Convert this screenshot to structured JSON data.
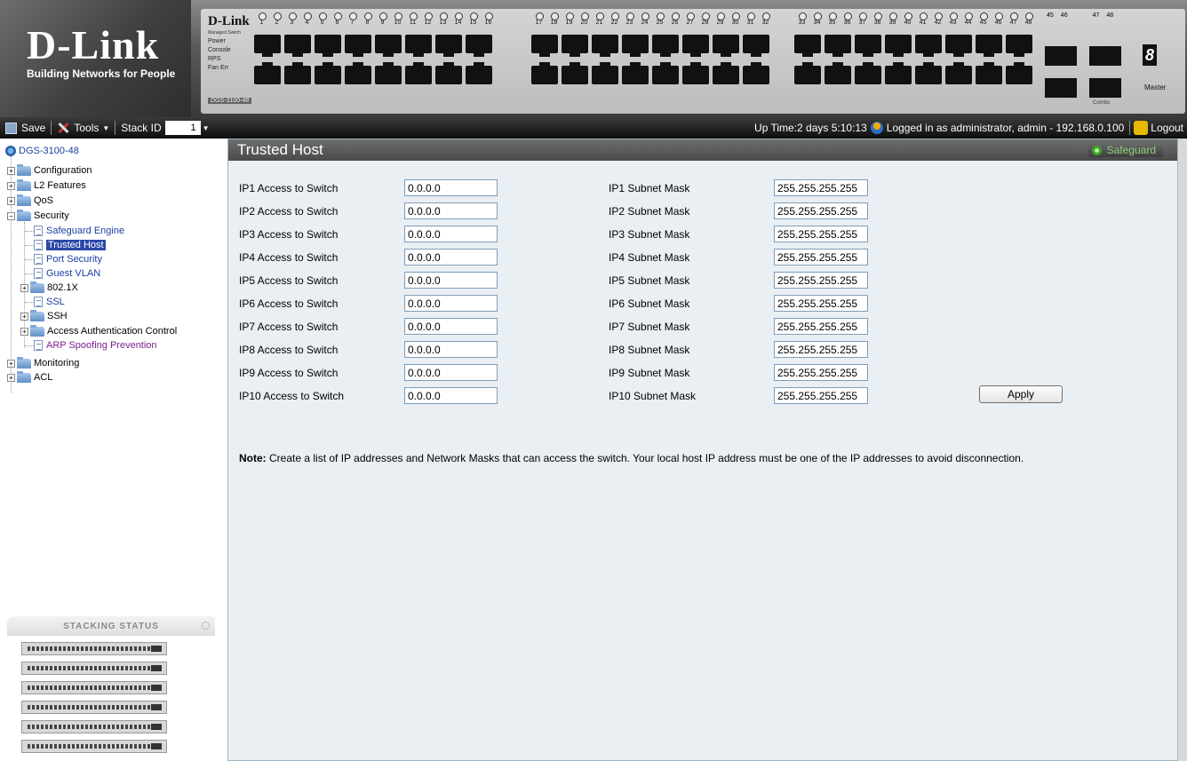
{
  "banner": {
    "logo": "D-Link",
    "tagline": "Building Networks for People",
    "switch_brand": "D-Link",
    "switch_subtitle": "Managed Switch",
    "leds": [
      "Power",
      "Console",
      "RPS",
      "Fan Err"
    ],
    "model": "DGS-3100-48",
    "port_numbers_1": [
      "1",
      "2",
      "3",
      "4",
      "5",
      "6",
      "7",
      "8",
      "9",
      "10",
      "11",
      "12",
      "13",
      "14",
      "15",
      "16"
    ],
    "port_numbers_2": [
      "17",
      "18",
      "19",
      "20",
      "21",
      "22",
      "23",
      "24",
      "25",
      "26",
      "27",
      "28",
      "29",
      "30",
      "31",
      "32"
    ],
    "port_numbers_3": [
      "33",
      "34",
      "35",
      "36",
      "37",
      "38",
      "39",
      "40",
      "41",
      "42",
      "43",
      "44",
      "45",
      "46",
      "47",
      "48"
    ],
    "combo_label": "Combo",
    "stack_digit": "8",
    "master_label": "Master",
    "combo_numbers": [
      "45",
      "46",
      "47",
      "48"
    ]
  },
  "toolbar": {
    "save_label": "Save",
    "tools_label": "Tools",
    "stack_id_label": "Stack ID",
    "stack_id_value": "1",
    "uptime": "Up Time:2 days 5:10:13",
    "logged_in": "Logged in as administrator, admin - 192.168.0.100",
    "logout_label": "Logout"
  },
  "tree": {
    "root": "DGS-3100-48",
    "configuration": "Configuration",
    "l2_features": "L2 Features",
    "qos": "QoS",
    "security": "Security",
    "safeguard_engine": "Safeguard Engine",
    "trusted_host": "Trusted Host",
    "port_security": "Port Security",
    "guest_vlan": "Guest VLAN",
    "dot1x": "802.1X",
    "ssl": "SSL",
    "ssh": "SSH",
    "aac": "Access Authentication Control",
    "arp": "ARP Spoofing Prevention",
    "monitoring": "Monitoring",
    "acl": "ACL"
  },
  "stacking": {
    "title": "STACKING STATUS",
    "unit_count": 6
  },
  "main": {
    "title": "Trusted Host",
    "safeguard_label": "Safeguard",
    "rows": [
      {
        "ip_label": "IP1 Access to Switch",
        "ip_value": "0.0.0.0",
        "mask_label": "IP1 Subnet Mask",
        "mask_value": "255.255.255.255"
      },
      {
        "ip_label": "IP2 Access to Switch",
        "ip_value": "0.0.0.0",
        "mask_label": "IP2 Subnet Mask",
        "mask_value": "255.255.255.255"
      },
      {
        "ip_label": "IP3 Access to Switch",
        "ip_value": "0.0.0.0",
        "mask_label": "IP3 Subnet Mask",
        "mask_value": "255.255.255.255"
      },
      {
        "ip_label": "IP4 Access to Switch",
        "ip_value": "0.0.0.0",
        "mask_label": "IP4 Subnet Mask",
        "mask_value": "255.255.255.255"
      },
      {
        "ip_label": "IP5 Access to Switch",
        "ip_value": "0.0.0.0",
        "mask_label": "IP5 Subnet Mask",
        "mask_value": "255.255.255.255"
      },
      {
        "ip_label": "IP6 Access to Switch",
        "ip_value": "0.0.0.0",
        "mask_label": "IP6 Subnet Mask",
        "mask_value": "255.255.255.255"
      },
      {
        "ip_label": "IP7 Access to Switch",
        "ip_value": "0.0.0.0",
        "mask_label": "IP7 Subnet Mask",
        "mask_value": "255.255.255.255"
      },
      {
        "ip_label": "IP8 Access to Switch",
        "ip_value": "0.0.0.0",
        "mask_label": "IP8 Subnet Mask",
        "mask_value": "255.255.255.255"
      },
      {
        "ip_label": "IP9 Access to Switch",
        "ip_value": "0.0.0.0",
        "mask_label": "IP9 Subnet Mask",
        "mask_value": "255.255.255.255"
      },
      {
        "ip_label": "IP10 Access to Switch",
        "ip_value": "0.0.0.0",
        "mask_label": "IP10 Subnet Mask",
        "mask_value": "255.255.255.255"
      }
    ],
    "apply_label": "Apply",
    "note_prefix": "Note:",
    "note_text": "Create a list of IP addresses and Network Masks that can access the switch. Your local host IP address must be one of the IP addresses to avoid disconnection."
  },
  "colors": {
    "title_bar": "#4a4a4a",
    "panel_bg": "#e9eff3",
    "selected_bg": "#2b48a8",
    "link_blue": "#1a3fa3",
    "link_purple": "#7b1f8c",
    "safeguard_green": "#3da62a"
  }
}
